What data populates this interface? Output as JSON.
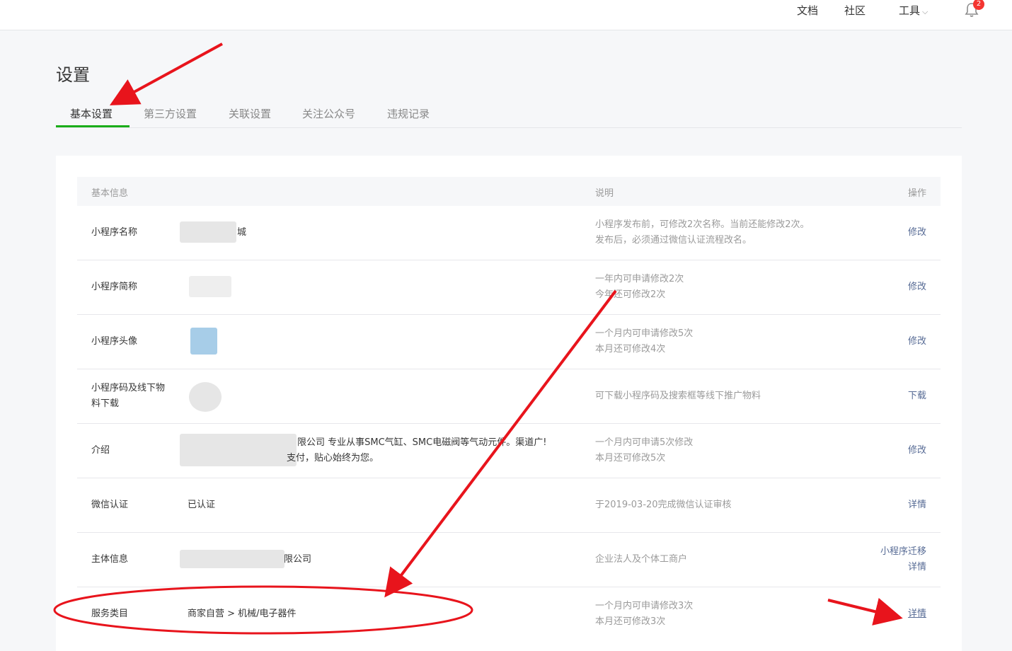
{
  "topbar": {
    "docs": "文档",
    "community": "社区",
    "tools": "工具",
    "notifications_count": "2"
  },
  "page": {
    "title": "设置"
  },
  "tabs": [
    {
      "label": "基本设置",
      "active": true
    },
    {
      "label": "第三方设置",
      "active": false
    },
    {
      "label": "关联设置",
      "active": false
    },
    {
      "label": "关注公众号",
      "active": false
    },
    {
      "label": "违规记录",
      "active": false
    }
  ],
  "table": {
    "headers": {
      "info": "基本信息",
      "desc": "说明",
      "action": "操作"
    },
    "rows": [
      {
        "label": "小程序名称",
        "value": "城",
        "desc1": "小程序发布前，可修改2次名称。当前还能修改2次。",
        "desc2": "发布后，必须通过微信认证流程改名。",
        "action": "修改"
      },
      {
        "label": "小程序简称",
        "value": "",
        "desc1": "一年内可申请修改2次",
        "desc2": "今年还可修改2次",
        "action": "修改"
      },
      {
        "label": "小程序头像",
        "value": "",
        "desc1": "一个月内可申请修改5次",
        "desc2": "本月还可修改4次",
        "action": "修改"
      },
      {
        "label1": "小程序码及线下物",
        "label2": "料下载",
        "desc1": "可下载小程序码及搜索框等线下推广物料",
        "action": "下载"
      },
      {
        "label": "介绍",
        "value1": "限公司 专业从事SMC气缸、SMC电磁阀等气动元件。渠道广!",
        "value2": "支付，贴心始终为您。",
        "desc1": "一个月内可申请5次修改",
        "desc2": "本月还可修改5次",
        "action": "修改"
      },
      {
        "label": "微信认证",
        "value": "已认证",
        "desc1": "于2019-03-20完成微信认证审核",
        "action": "详情"
      },
      {
        "label": "主体信息",
        "value": "限公司",
        "desc1": "企业法人及个体工商户",
        "action1": "小程序迁移",
        "action2": "详情"
      },
      {
        "label": "服务类目",
        "value": "商家自营 > 机械/电子器件",
        "desc1": "一个月内可申请修改3次",
        "desc2": "本月还可修改3次",
        "action": "详情"
      }
    ]
  },
  "colors": {
    "accent_green": "#1aad19",
    "link_blue": "#576b95",
    "annotation_red": "#e8141c",
    "badge_red": "#f43530"
  }
}
